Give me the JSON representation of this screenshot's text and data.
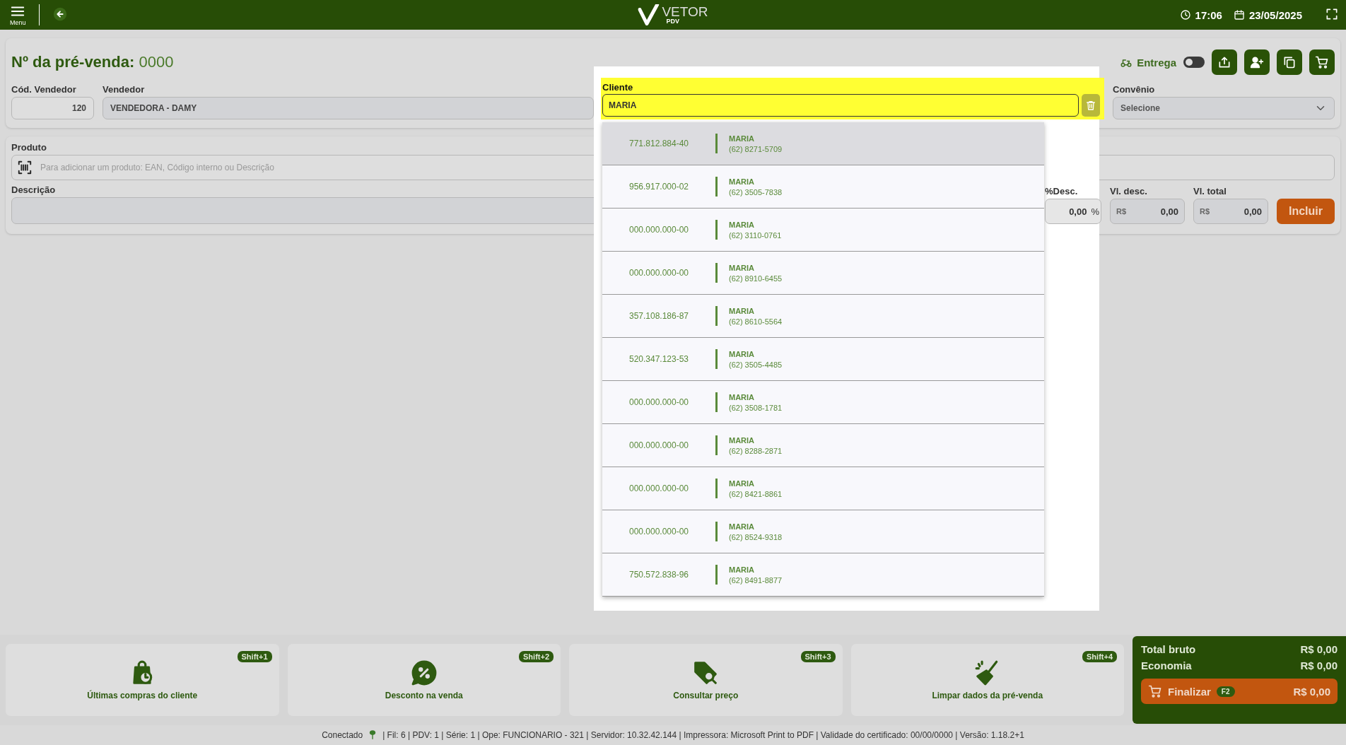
{
  "topbar": {
    "menu_label": "Menu",
    "logo_text": "VETOR",
    "logo_sub": "PDV",
    "time": "17:06",
    "date": "23/05/2025"
  },
  "header": {
    "title_label": "Nº da pré-venda:",
    "title_value": "0000",
    "delivery": {
      "label": "Entrega",
      "on": false
    }
  },
  "seller_code": {
    "label": "Cód. Vendedor",
    "value": "120"
  },
  "seller": {
    "label": "Vendedor",
    "value": "VENDEDORA - DAMY"
  },
  "client": {
    "label": "Cliente",
    "value": "MARIA"
  },
  "covenant": {
    "label": "Convênio",
    "value": "Selecione"
  },
  "client_results": [
    {
      "document": "771.812.884-40",
      "name": "MARIA",
      "phone": "(62) 8271-5709",
      "selected": true
    },
    {
      "document": "956.917.000-02",
      "name": "MARIA",
      "phone": "(62) 3505-7838",
      "selected": false
    },
    {
      "document": "000.000.000-00",
      "name": "MARIA",
      "phone": "(62) 3110-0761",
      "selected": false
    },
    {
      "document": "000.000.000-00",
      "name": "MARIA",
      "phone": "(62) 8910-6455",
      "selected": false
    },
    {
      "document": "357.108.186-87",
      "name": "MARIA",
      "phone": "(62) 8610-5564",
      "selected": false
    },
    {
      "document": "520.347.123-53",
      "name": "MARIA",
      "phone": "(62) 3505-4485",
      "selected": false
    },
    {
      "document": "000.000.000-00",
      "name": "MARIA",
      "phone": "(62) 3508-1781",
      "selected": false
    },
    {
      "document": "000.000.000-00",
      "name": "MARIA",
      "phone": "(62) 8288-2871",
      "selected": false
    },
    {
      "document": "000.000.000-00",
      "name": "MARIA",
      "phone": "(62) 8421-8861",
      "selected": false
    },
    {
      "document": "000.000.000-00",
      "name": "MARIA",
      "phone": "(62) 8524-9318",
      "selected": false
    },
    {
      "document": "750.572.838-96",
      "name": "MARIA",
      "phone": "(62) 8491-8877",
      "selected": false
    }
  ],
  "product": {
    "label": "Produto",
    "placeholder": "Para adicionar um produto: EAN, Código interno ou Descrição"
  },
  "description": {
    "label": "Descrição"
  },
  "discount_pct": {
    "label": "%Desc.",
    "value": "0,00",
    "unit": "%"
  },
  "discount_value": {
    "label": "Vl. desc.",
    "currency": "R$",
    "value": "0,00"
  },
  "total_value": {
    "label": "Vl. total",
    "currency": "R$",
    "value": "0,00"
  },
  "include_button": "Incluir",
  "actions": [
    {
      "kind": "history",
      "label": "Últimas compras do cliente",
      "shortcut": "Shift+1"
    },
    {
      "kind": "discount",
      "label": "Desconto na venda",
      "shortcut": "Shift+2"
    },
    {
      "kind": "price",
      "label": "Consultar preço",
      "shortcut": "Shift+3"
    },
    {
      "kind": "clear",
      "label": "Limpar dados da pré-venda",
      "shortcut": "Shift+4"
    }
  ],
  "totals": {
    "rows": [
      {
        "label": "Total bruto",
        "value": "R$ 0,00"
      },
      {
        "label": "Economia",
        "value": "R$ 0,00"
      }
    ],
    "finalize": {
      "label": "Finalizar",
      "key": "F2",
      "value": "R$ 0,00"
    }
  },
  "status_bar": {
    "connection": "Conectado",
    "info": "| Fil: 6 | PDV: 1 | Série: 1 | Ope: FUNCIONARIO - 321 | Servidor: 10.32.42.144 | Impressora: Microsoft Print to PDF | Validade do certificado: 00/00/0000 | Versão: 1.18.2+1"
  }
}
